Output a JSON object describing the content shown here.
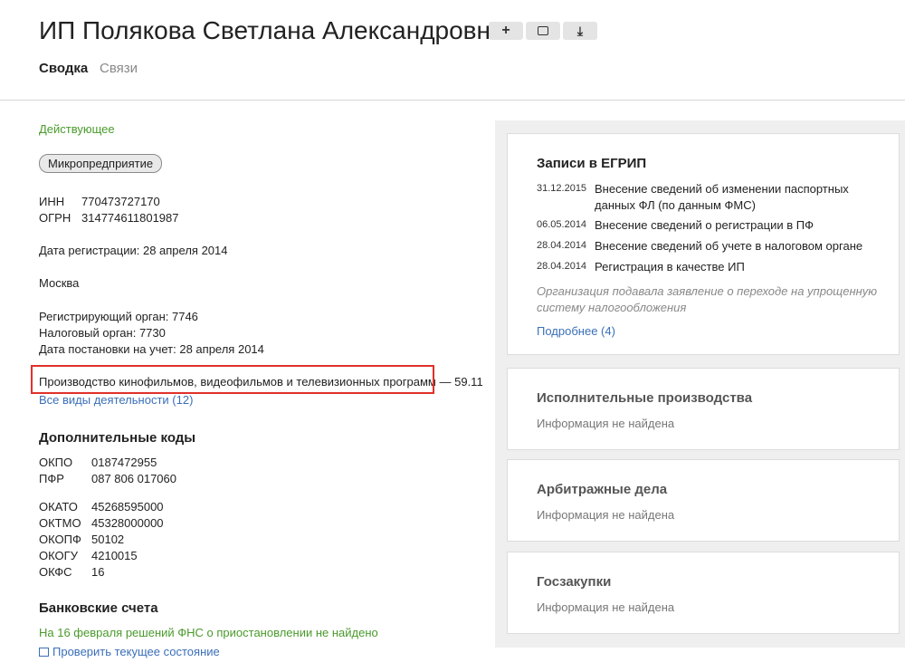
{
  "header": {
    "title": "ИП Полякова Светлана Александровна",
    "buttons": [
      {
        "icon": "plus-icon",
        "glyph": "+"
      },
      {
        "icon": "comment-icon",
        "glyph": "💬"
      },
      {
        "icon": "download-icon",
        "glyph": "⤓"
      }
    ],
    "tabs": [
      "Сводка",
      "Связи"
    ]
  },
  "summary": {
    "status": "Действующее",
    "badge": "Микропредприятие",
    "inn_label": "ИНН",
    "inn": "770473727170",
    "ogrn_label": "ОГРН",
    "ogrn": "314774611801987",
    "reg_date": "Дата регистрации: 28 апреля 2014",
    "city": "Москва",
    "reg_org": "Регистрирующий орган: 7746",
    "tax_org": "Налоговый орган: 7730",
    "tax_date": "Дата постановки на учет: 28 апреля 2014",
    "okved_main": "Производство кинофильмов, видеофильмов и телевизионных программ",
    "okved_code": "— 59.11",
    "all_activities": "Все виды деятельности (12)"
  },
  "codes": {
    "title": "Дополнительные коды",
    "group1": [
      {
        "k": "ОКПО",
        "v": "0187472955"
      },
      {
        "k": "ПФР",
        "v": "087 806 017060"
      }
    ],
    "group2": [
      {
        "k": "ОКАТО",
        "v": "45268595000"
      },
      {
        "k": "ОКТМО",
        "v": "45328000000"
      },
      {
        "k": "ОКОПФ",
        "v": "50102"
      },
      {
        "k": "ОКОГУ",
        "v": "4210015"
      },
      {
        "k": "ОКФС",
        "v": "16"
      }
    ]
  },
  "bank": {
    "title": "Банковские счета",
    "status": "На 16 февраля решений ФНС о приостановлении не найдено",
    "check_link": "Проверить текущее состояние"
  },
  "egrip": {
    "title": "Записи в ЕГРИП",
    "records": [
      {
        "date": "31.12.2015",
        "text": "Внесение сведений об изменении паспортных данных ФЛ (по данным ФМС)"
      },
      {
        "date": "06.05.2014",
        "text": "Внесение сведений о регистрации в ПФ"
      },
      {
        "date": "28.04.2014",
        "text": "Внесение сведений об учете в налоговом органе"
      },
      {
        "date": "28.04.2014",
        "text": "Регистрация в качестве ИП"
      }
    ],
    "note": "Организация подавала заявление о переходе на упрощенную систему налогообложения",
    "more_link": "Подробнее (4)"
  },
  "cards": [
    {
      "title": "Исполнительные производства",
      "text": "Информация не найдена"
    },
    {
      "title": "Арбитражные дела",
      "text": "Информация не найдена"
    },
    {
      "title": "Госзакупки",
      "text": "Информация не найдена"
    }
  ]
}
